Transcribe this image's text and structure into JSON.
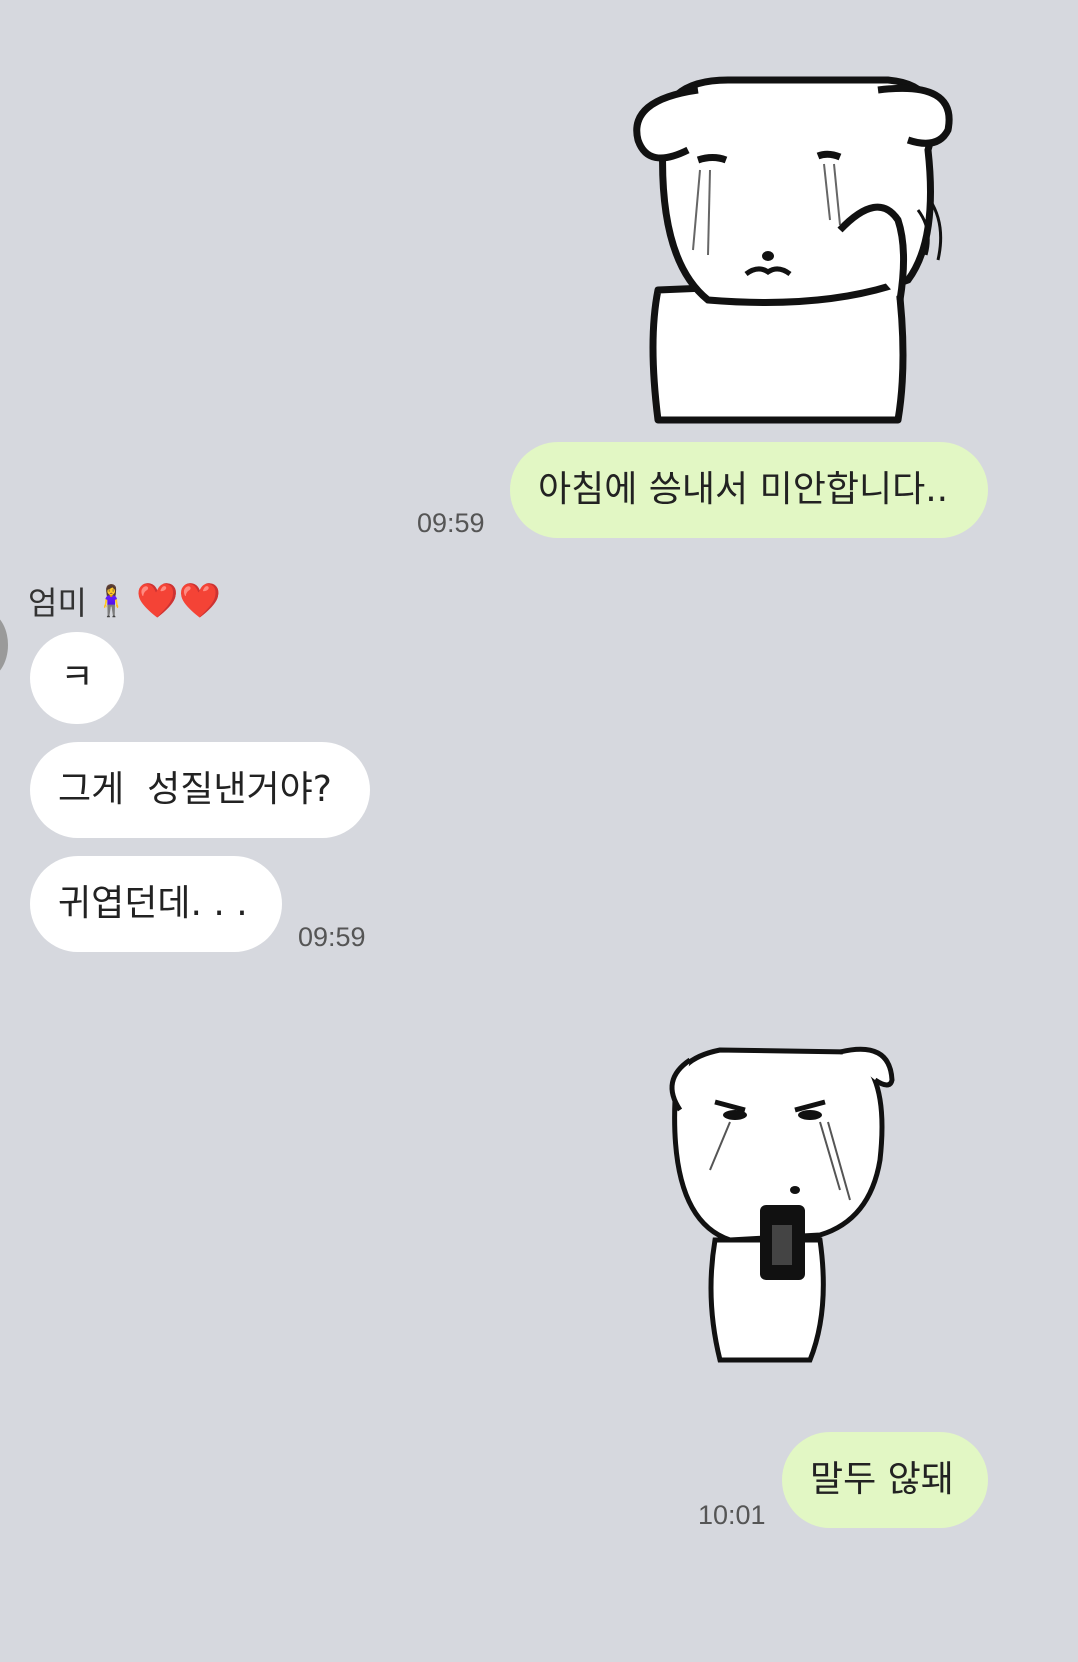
{
  "messages": [
    {
      "from": "me",
      "type": "sticker",
      "sticker_name": "crying-dog-sticker"
    },
    {
      "from": "me",
      "type": "text",
      "text": "아침에 씅내서 미안합니다..",
      "time": "09:59"
    },
    {
      "from": "other",
      "sender": "엄미",
      "sender_emoji": "🧍‍♀️",
      "sender_hearts": "❤️❤️",
      "texts": [
        "ㅋ",
        "그게  성질낸거야?",
        "귀엽던데. . ."
      ],
      "time": "09:59"
    },
    {
      "from": "me",
      "type": "sticker",
      "sticker_name": "angry-crying-dog-sticker"
    },
    {
      "from": "me",
      "type": "text",
      "text": "말두 않돼",
      "time": "10:01"
    }
  ],
  "colors": {
    "background": "#d6d8de",
    "my_bubble": "#e2f7c4",
    "other_bubble": "#ffffff"
  }
}
